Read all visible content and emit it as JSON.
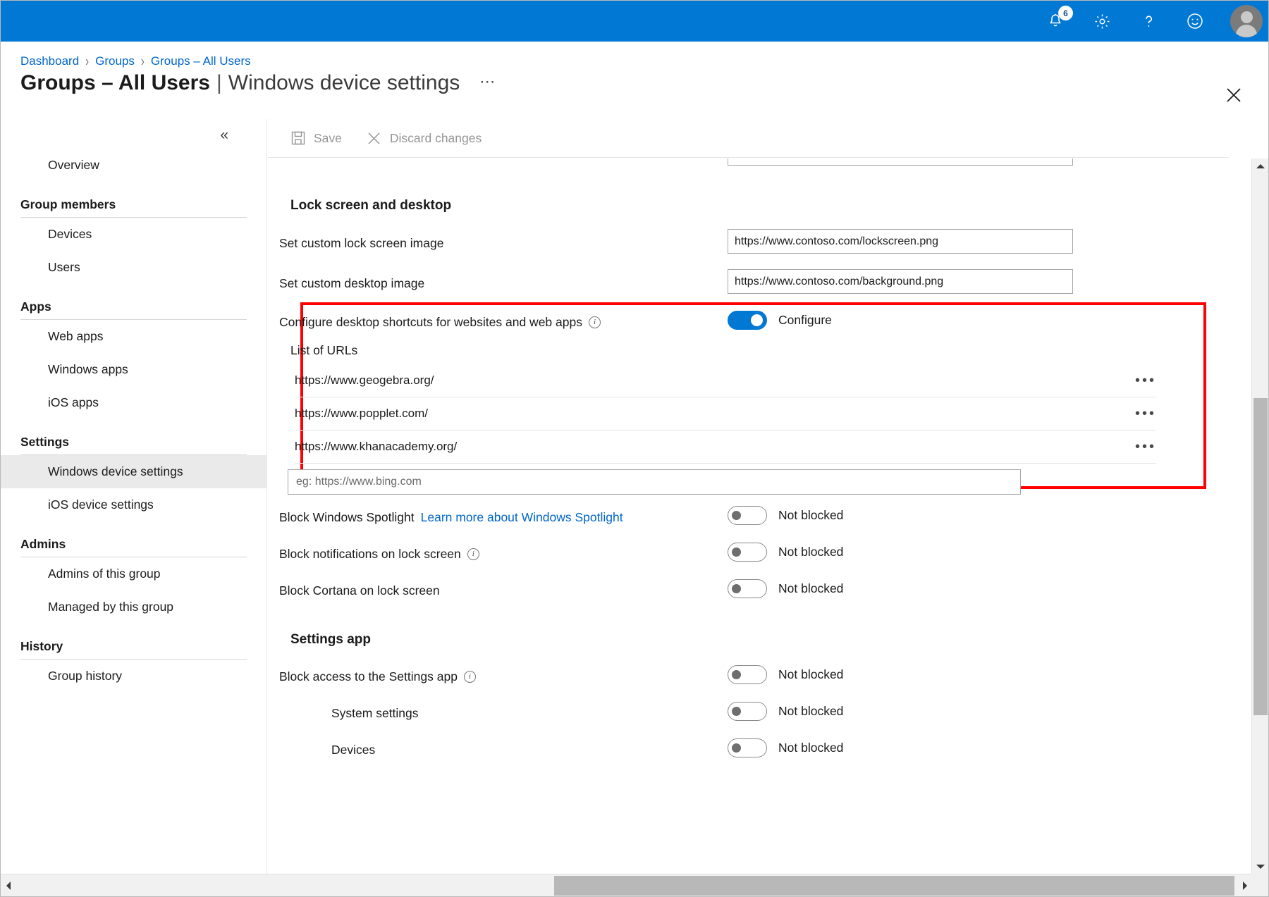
{
  "topbar": {
    "notifications_icon": "bell-icon",
    "notifications_count": "6",
    "settings_icon": "gear-icon",
    "help_icon": "question-mark-icon",
    "feedback_icon": "smiley-face-icon",
    "avatar_icon": "user-avatar",
    "background_color": "#0078d4"
  },
  "breadcrumb": {
    "items": [
      {
        "label": "Dashboard"
      },
      {
        "label": "Groups"
      },
      {
        "label": "Groups – All Users"
      }
    ],
    "separator": "›"
  },
  "page": {
    "title_strong": "Groups – All Users",
    "title_separator": "|",
    "title_light": "Windows device settings",
    "more_label": "⋯",
    "close_label": "close-blade"
  },
  "sidebar": {
    "collapse_label": "«",
    "top_items": [
      {
        "label": "Overview",
        "selected": false
      }
    ],
    "groups": [
      {
        "label": "Group members",
        "items": [
          {
            "label": "Devices",
            "selected": false
          },
          {
            "label": "Users",
            "selected": false
          }
        ]
      },
      {
        "label": "Apps",
        "items": [
          {
            "label": "Web apps",
            "selected": false
          },
          {
            "label": "Windows apps",
            "selected": false
          },
          {
            "label": "iOS apps",
            "selected": false
          }
        ]
      },
      {
        "label": "Settings",
        "items": [
          {
            "label": "Windows device settings",
            "selected": true
          },
          {
            "label": "iOS device settings",
            "selected": false
          }
        ]
      },
      {
        "label": "Admins",
        "items": [
          {
            "label": "Admins of this group",
            "selected": false
          },
          {
            "label": "Managed by this group",
            "selected": false
          }
        ]
      },
      {
        "label": "History",
        "items": [
          {
            "label": "Group history",
            "selected": false
          }
        ]
      }
    ]
  },
  "toolbar": {
    "save_label": "Save",
    "save_icon": "save-floppy-icon",
    "discard_label": "Discard changes",
    "discard_icon": "close-x-icon"
  },
  "content": {
    "sections": [
      {
        "heading": "Lock screen and desktop",
        "rows": [
          {
            "label": "Set custom lock screen image",
            "type": "textbox",
            "value": "https://www.contoso.com/lockscreen.png"
          },
          {
            "label": "Set custom desktop image",
            "type": "textbox",
            "value": "https://www.contoso.com/background.png"
          }
        ]
      }
    ],
    "highlighted": {
      "label": "Configure desktop shortcuts for websites and web apps",
      "has_info_icon": true,
      "toggle_state": "on",
      "toggle_text": "Configure",
      "toggle_color": "#0078d4",
      "list_label": "List of URLs",
      "urls": [
        {
          "value": "https://www.geogebra.org/",
          "menu": "•••"
        },
        {
          "value": "https://www.popplet.com/",
          "menu": "•••"
        },
        {
          "value": "https://www.khanacademy.org/",
          "menu": "•••"
        }
      ],
      "new_url_placeholder": "eg: https://www.bing.com",
      "highlight_color": "#ff0000"
    },
    "after_rows": [
      {
        "label": "Block Windows Spotlight",
        "link_label": "Learn more about Windows Spotlight",
        "toggle_state": "off",
        "toggle_text": "Not blocked",
        "has_info_icon": false,
        "indent": 1
      },
      {
        "label": "Block notifications on lock screen",
        "link_label": "",
        "toggle_state": "off",
        "toggle_text": "Not blocked",
        "has_info_icon": true,
        "indent": 1
      },
      {
        "label": "Block Cortana on lock screen",
        "link_label": "",
        "toggle_state": "off",
        "toggle_text": "Not blocked",
        "has_info_icon": false,
        "indent": 1
      }
    ],
    "settings_app": {
      "heading": "Settings app",
      "rows": [
        {
          "label": "Block access to the Settings app",
          "toggle_state": "off",
          "toggle_text": "Not blocked",
          "has_info_icon": true,
          "indent": 1
        },
        {
          "label": "System settings",
          "toggle_state": "off",
          "toggle_text": "Not blocked",
          "has_info_icon": false,
          "indent": 2
        },
        {
          "label": "Devices",
          "toggle_state": "off",
          "toggle_text": "Not blocked",
          "has_info_icon": false,
          "indent": 2
        }
      ]
    }
  },
  "scrollbars": {
    "vertical_up_arrow": "▲",
    "vertical_down_arrow": "▼",
    "horizontal_left_arrow": "◀",
    "horizontal_right_arrow": "▶"
  }
}
